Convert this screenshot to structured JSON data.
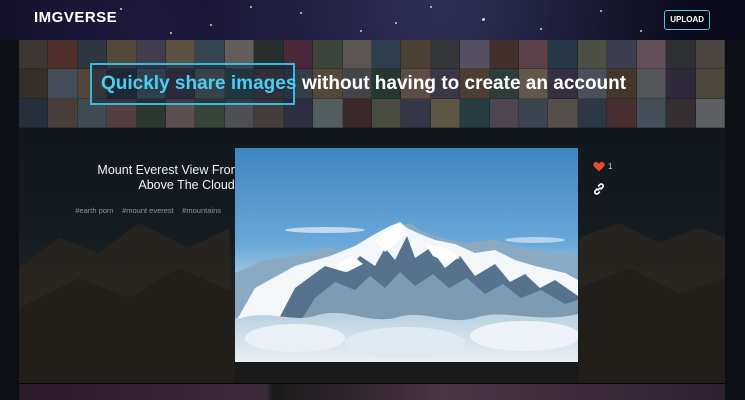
{
  "header": {
    "logo": "IMGVERSE",
    "upload_label": "UPLOAD"
  },
  "banner": {
    "tagline_highlight": "Quickly share images",
    "tagline_rest": "without having to create an account"
  },
  "post": {
    "title_line1": "Mount Everest View From",
    "title_line2": "Above The Clouds",
    "tags": [
      "#earth porn",
      "#mount everest",
      "#mountains"
    ],
    "like_count": "1"
  },
  "colors": {
    "accent": "#4ecdf4",
    "heart": "#e8492f",
    "button_border": "#4fc7e6"
  },
  "icons": [
    "heart-icon",
    "link-icon"
  ]
}
